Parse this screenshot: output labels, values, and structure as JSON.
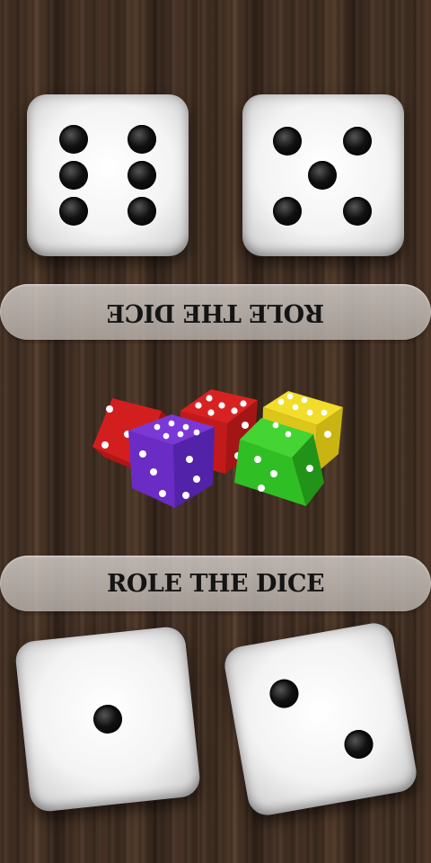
{
  "players": {
    "top": {
      "roll_label": "ROLE THE DICE",
      "dice": [
        6,
        5
      ]
    },
    "bottom": {
      "roll_label": "ROLE THE DICE",
      "dice": [
        1,
        2
      ]
    }
  },
  "logo": {
    "icon": "colored-dice-cluster-icon",
    "colors": {
      "red": "#d21e1e",
      "purple": "#6a2cc4",
      "yellow": "#e8d21a",
      "green": "#2fbf24"
    }
  },
  "colors": {
    "button_bg": "#cfc9c5",
    "button_text": "#141414",
    "die_face": "#f3f3f3",
    "pip": "#000000"
  }
}
